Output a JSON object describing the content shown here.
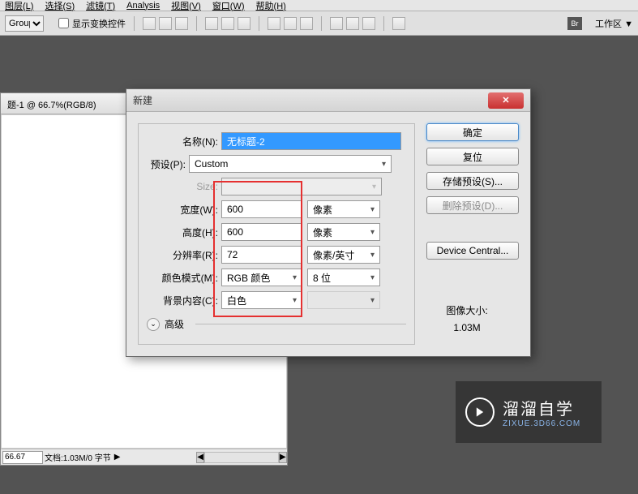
{
  "menu": {
    "items": [
      "图层(L)",
      "选择(S)",
      "滤镜(T)",
      "Analysis",
      "视图(V)",
      "窗口(W)",
      "帮助(H)"
    ]
  },
  "toolbar": {
    "group": "Group",
    "show_transform": "显示变换控件",
    "workspace": "工作区 ▼",
    "br": "Br"
  },
  "doc": {
    "title": "题-1 @ 66.7%(RGB/8)",
    "status_left": "66.67",
    "status_doc": "文档:1.03M/0 字节"
  },
  "dialog": {
    "title": "新建",
    "labels": {
      "name": "名称(N):",
      "preset": "预设(P):",
      "size": "Size:",
      "width": "宽度(W):",
      "height": "高度(H):",
      "resolution": "分辨率(R):",
      "color_mode": "颜色模式(M):",
      "bg": "背景内容(C):",
      "advanced": "高级"
    },
    "values": {
      "name": "无标题-2",
      "preset": "Custom",
      "size": "",
      "width": "600",
      "height": "600",
      "resolution": "72",
      "color_mode": "RGB 颜色",
      "bits": "8 位",
      "bg": "白色"
    },
    "units": {
      "pixels": "像素",
      "ppi": "像素/英寸"
    },
    "buttons": {
      "ok": "确定",
      "reset": "复位",
      "save_preset": "存储预设(S)...",
      "delete_preset": "删除预设(D)...",
      "device_central": "Device Central..."
    },
    "size_info": {
      "label": "图像大小:",
      "value": "1.03M"
    }
  },
  "watermark": {
    "main": "溜溜自学",
    "sub": "ZIXUE.3D66.COM"
  }
}
